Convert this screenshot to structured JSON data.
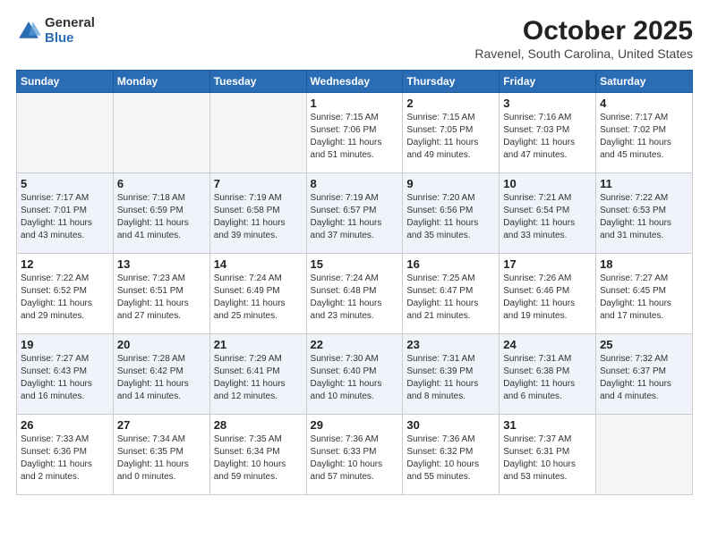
{
  "header": {
    "logo_general": "General",
    "logo_blue": "Blue",
    "month": "October 2025",
    "location": "Ravenel, South Carolina, United States"
  },
  "weekdays": [
    "Sunday",
    "Monday",
    "Tuesday",
    "Wednesday",
    "Thursday",
    "Friday",
    "Saturday"
  ],
  "weeks": [
    [
      {
        "day": "",
        "info": ""
      },
      {
        "day": "",
        "info": ""
      },
      {
        "day": "",
        "info": ""
      },
      {
        "day": "1",
        "info": "Sunrise: 7:15 AM\nSunset: 7:06 PM\nDaylight: 11 hours\nand 51 minutes."
      },
      {
        "day": "2",
        "info": "Sunrise: 7:15 AM\nSunset: 7:05 PM\nDaylight: 11 hours\nand 49 minutes."
      },
      {
        "day": "3",
        "info": "Sunrise: 7:16 AM\nSunset: 7:03 PM\nDaylight: 11 hours\nand 47 minutes."
      },
      {
        "day": "4",
        "info": "Sunrise: 7:17 AM\nSunset: 7:02 PM\nDaylight: 11 hours\nand 45 minutes."
      }
    ],
    [
      {
        "day": "5",
        "info": "Sunrise: 7:17 AM\nSunset: 7:01 PM\nDaylight: 11 hours\nand 43 minutes."
      },
      {
        "day": "6",
        "info": "Sunrise: 7:18 AM\nSunset: 6:59 PM\nDaylight: 11 hours\nand 41 minutes."
      },
      {
        "day": "7",
        "info": "Sunrise: 7:19 AM\nSunset: 6:58 PM\nDaylight: 11 hours\nand 39 minutes."
      },
      {
        "day": "8",
        "info": "Sunrise: 7:19 AM\nSunset: 6:57 PM\nDaylight: 11 hours\nand 37 minutes."
      },
      {
        "day": "9",
        "info": "Sunrise: 7:20 AM\nSunset: 6:56 PM\nDaylight: 11 hours\nand 35 minutes."
      },
      {
        "day": "10",
        "info": "Sunrise: 7:21 AM\nSunset: 6:54 PM\nDaylight: 11 hours\nand 33 minutes."
      },
      {
        "day": "11",
        "info": "Sunrise: 7:22 AM\nSunset: 6:53 PM\nDaylight: 11 hours\nand 31 minutes."
      }
    ],
    [
      {
        "day": "12",
        "info": "Sunrise: 7:22 AM\nSunset: 6:52 PM\nDaylight: 11 hours\nand 29 minutes."
      },
      {
        "day": "13",
        "info": "Sunrise: 7:23 AM\nSunset: 6:51 PM\nDaylight: 11 hours\nand 27 minutes."
      },
      {
        "day": "14",
        "info": "Sunrise: 7:24 AM\nSunset: 6:49 PM\nDaylight: 11 hours\nand 25 minutes."
      },
      {
        "day": "15",
        "info": "Sunrise: 7:24 AM\nSunset: 6:48 PM\nDaylight: 11 hours\nand 23 minutes."
      },
      {
        "day": "16",
        "info": "Sunrise: 7:25 AM\nSunset: 6:47 PM\nDaylight: 11 hours\nand 21 minutes."
      },
      {
        "day": "17",
        "info": "Sunrise: 7:26 AM\nSunset: 6:46 PM\nDaylight: 11 hours\nand 19 minutes."
      },
      {
        "day": "18",
        "info": "Sunrise: 7:27 AM\nSunset: 6:45 PM\nDaylight: 11 hours\nand 17 minutes."
      }
    ],
    [
      {
        "day": "19",
        "info": "Sunrise: 7:27 AM\nSunset: 6:43 PM\nDaylight: 11 hours\nand 16 minutes."
      },
      {
        "day": "20",
        "info": "Sunrise: 7:28 AM\nSunset: 6:42 PM\nDaylight: 11 hours\nand 14 minutes."
      },
      {
        "day": "21",
        "info": "Sunrise: 7:29 AM\nSunset: 6:41 PM\nDaylight: 11 hours\nand 12 minutes."
      },
      {
        "day": "22",
        "info": "Sunrise: 7:30 AM\nSunset: 6:40 PM\nDaylight: 11 hours\nand 10 minutes."
      },
      {
        "day": "23",
        "info": "Sunrise: 7:31 AM\nSunset: 6:39 PM\nDaylight: 11 hours\nand 8 minutes."
      },
      {
        "day": "24",
        "info": "Sunrise: 7:31 AM\nSunset: 6:38 PM\nDaylight: 11 hours\nand 6 minutes."
      },
      {
        "day": "25",
        "info": "Sunrise: 7:32 AM\nSunset: 6:37 PM\nDaylight: 11 hours\nand 4 minutes."
      }
    ],
    [
      {
        "day": "26",
        "info": "Sunrise: 7:33 AM\nSunset: 6:36 PM\nDaylight: 11 hours\nand 2 minutes."
      },
      {
        "day": "27",
        "info": "Sunrise: 7:34 AM\nSunset: 6:35 PM\nDaylight: 11 hours\nand 0 minutes."
      },
      {
        "day": "28",
        "info": "Sunrise: 7:35 AM\nSunset: 6:34 PM\nDaylight: 10 hours\nand 59 minutes."
      },
      {
        "day": "29",
        "info": "Sunrise: 7:36 AM\nSunset: 6:33 PM\nDaylight: 10 hours\nand 57 minutes."
      },
      {
        "day": "30",
        "info": "Sunrise: 7:36 AM\nSunset: 6:32 PM\nDaylight: 10 hours\nand 55 minutes."
      },
      {
        "day": "31",
        "info": "Sunrise: 7:37 AM\nSunset: 6:31 PM\nDaylight: 10 hours\nand 53 minutes."
      },
      {
        "day": "",
        "info": ""
      }
    ]
  ]
}
